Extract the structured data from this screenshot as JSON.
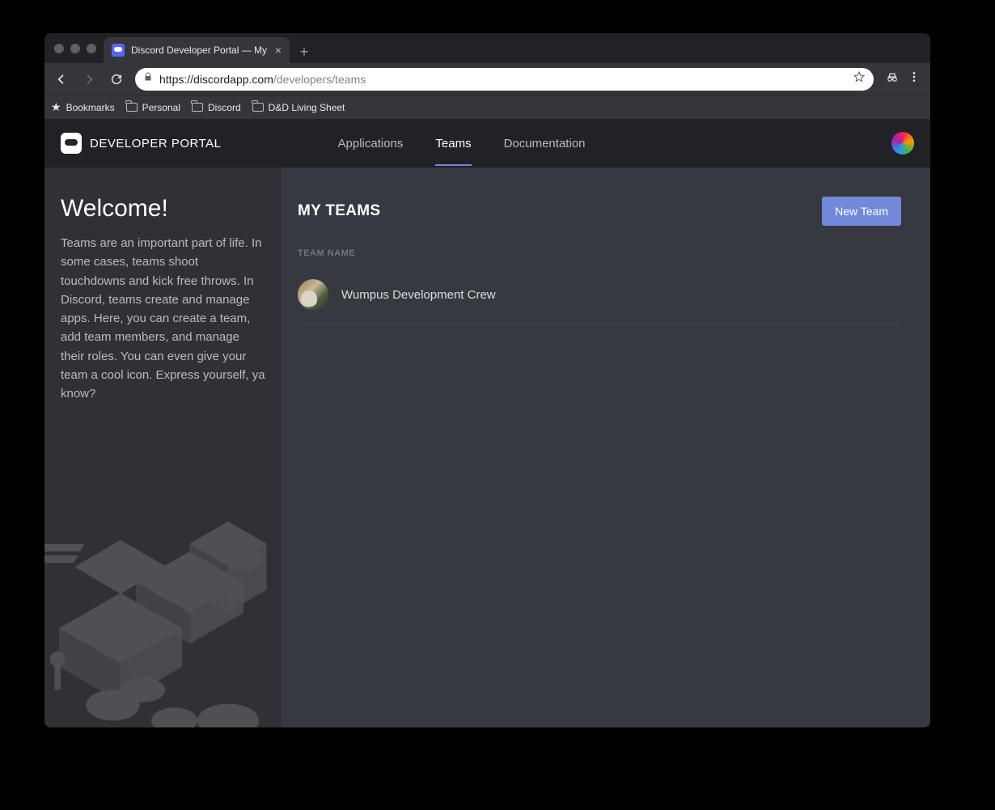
{
  "browser": {
    "tab_title": "Discord Developer Portal — My",
    "url_secure_prefix": "https://",
    "url_host": "discordapp.com",
    "url_path": "/developers/teams",
    "bookmarks": [
      "Bookmarks",
      "Personal",
      "Discord",
      "D&D Living Sheet"
    ]
  },
  "header": {
    "logo_text": "DEVELOPER PORTAL",
    "tabs": [
      {
        "label": "Applications",
        "active": false
      },
      {
        "label": "Teams",
        "active": true
      },
      {
        "label": "Documentation",
        "active": false
      }
    ]
  },
  "sidebar": {
    "title": "Welcome!",
    "body": "Teams are an important part of life. In some cases, teams shoot touchdowns and kick free throws. In Discord, teams create and manage apps. Here, you can create a team, add team members, and manage their roles. You can even give your team a cool icon. Express yourself, ya know?"
  },
  "main": {
    "title": "MY TEAMS",
    "new_team_label": "New Team",
    "column_header": "TEAM NAME",
    "teams": [
      {
        "name": "Wumpus Development Crew"
      }
    ]
  }
}
